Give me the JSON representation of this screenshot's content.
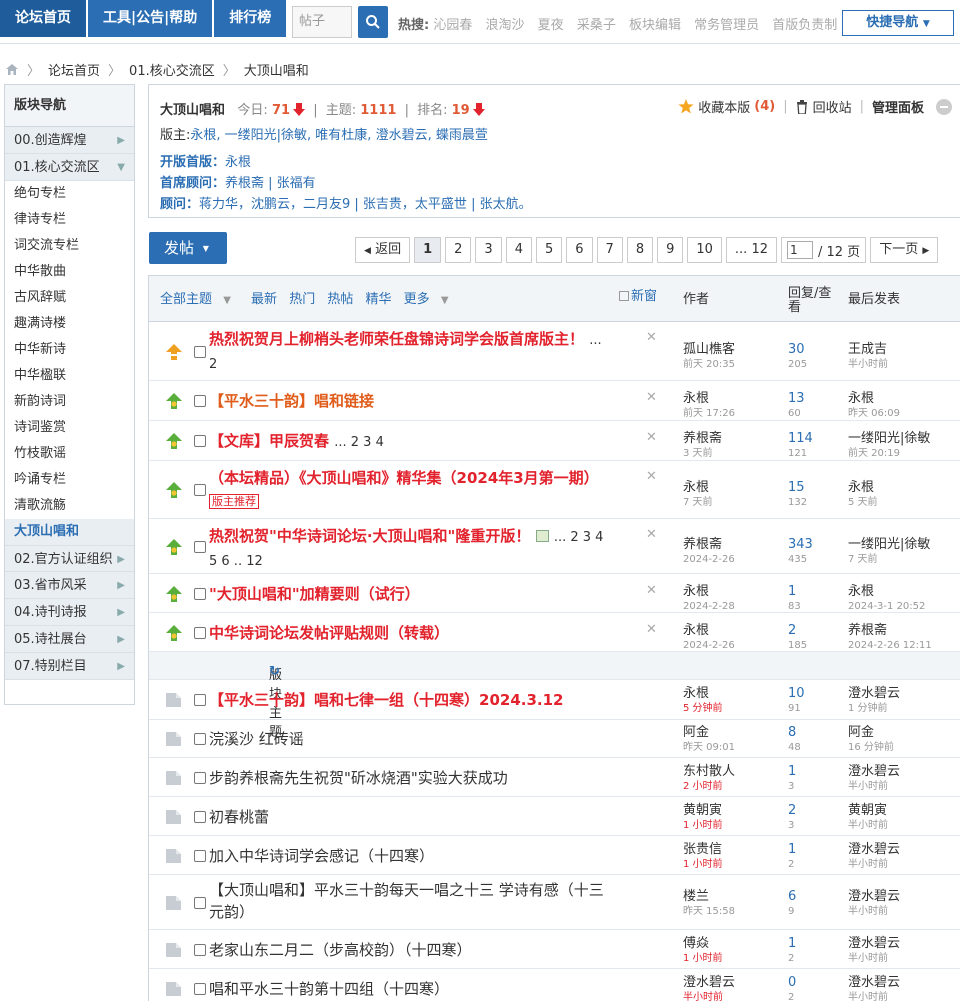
{
  "topnav": {
    "items": [
      "论坛首页",
      "工具|公告|帮助",
      "排行榜"
    ]
  },
  "search": {
    "placeholder": "帖子",
    "scope": "帖子"
  },
  "hot": {
    "label": "热搜:",
    "items": [
      "沁园春",
      "浪淘沙",
      "夏夜",
      "采桑子",
      "板块编辑",
      "常务管理员",
      "首版负责制"
    ]
  },
  "quicknav": "快捷导航",
  "breadcrumb": [
    "论坛首页",
    "01.核心交流区",
    "大顶山唱和"
  ],
  "sidebar": {
    "title": "版块导航",
    "groups_top": [
      "00.创造辉煌",
      "01.核心交流区"
    ],
    "items": [
      "绝句专栏",
      "律诗专栏",
      "词交流专栏",
      "中华散曲",
      "古风辞赋",
      "趣满诗楼",
      "中华新诗",
      "中华楹联",
      "新韵诗词",
      "诗词鉴赏",
      "竹枝歌谣",
      "吟诵专栏",
      "清歌流觞",
      "大顶山唱和"
    ],
    "groups_bottom": [
      "02.官方认证组织",
      "03.省市风采",
      "04.诗刊诗报",
      "05.诗社展台",
      "07.特别栏目"
    ]
  },
  "forum": {
    "name": "大顶山唱和",
    "today_label": "今日:",
    "today": "71",
    "topics_label": "主题:",
    "topics": "1111",
    "rank_label": "排名:",
    "rank": "19",
    "moderators_label": "版主:",
    "moderators": "永根, 一缕阳光|徐敏, 唯有杜康, 澄水碧云, 蝶雨晨萱",
    "first_label": "开版首版：",
    "first": "永根",
    "chief_label": "首席顾问：",
    "chief": "养根斋 | 张福有",
    "advisor_label": "顾问：",
    "advisors": "蒋力华，沈鹏云，二月友9 | 张吉贵，太平盛世 | 张太航。",
    "fav_label": "收藏本版",
    "fav_count": "(4)",
    "recycle": "回收站",
    "manage": "管理面板"
  },
  "post_button": "发帖",
  "pager": {
    "prev": "返回",
    "pages": [
      "1",
      "2",
      "3",
      "4",
      "5",
      "6",
      "7",
      "8",
      "9",
      "10",
      "... 12"
    ],
    "input": "1",
    "total": "/ 12 页",
    "next": "下一页"
  },
  "thead": {
    "filters": [
      "全部主题",
      "最新",
      "热门",
      "热帖",
      "精华",
      "更多"
    ],
    "newwin": "新窗",
    "author": "作者",
    "replies": "回复/查看",
    "last": "最后发表"
  },
  "sticky": [
    {
      "title": "热烈祝贺月上柳梢头老师荣任盘锦诗词学会版首席版主！",
      "pages": "... 2",
      "color": "red",
      "author": "孤山樵客",
      "adate": "前天 20:35",
      "replies": "30",
      "views": "205",
      "last": "王成吉",
      "ldate": "半小时前"
    },
    {
      "title": "【平水三十韵】唱和链接",
      "pages": "",
      "color": "orange",
      "author": "永根",
      "adate": "前天 17:26",
      "replies": "13",
      "views": "60",
      "last": "永根",
      "ldate": "昨天 06:09"
    },
    {
      "title": "【文库】甲辰贺春",
      "pages": "... 2 3 4",
      "color": "red",
      "author": "养根斋",
      "adate": "3 天前",
      "replies": "114",
      "views": "121",
      "last": "一缕阳光|徐敏",
      "ldate": "前天 20:19"
    },
    {
      "title": "（本坛精品）《大顶山唱和》精华集（2024年3月第一期）",
      "pages": "",
      "tag": "版主推荐",
      "color": "red",
      "author": "永根",
      "adate": "7 天前",
      "replies": "15",
      "views": "132",
      "last": "永根",
      "ldate": "5 天前"
    },
    {
      "title": "热烈祝贺\"中华诗词论坛·大顶山唱和\"隆重开版！",
      "pages": "... 2 3 4 5 6 .. 12",
      "color": "red",
      "author": "养根斋",
      "adate": "2024-2-26",
      "replies": "343",
      "views": "435",
      "last": "一缕阳光|徐敏",
      "ldate": "7 天前"
    },
    {
      "title": "\"大顶山唱和\"加精要则（试行）",
      "pages": "",
      "color": "red",
      "author": "永根",
      "adate": "2024-2-28",
      "replies": "1",
      "views": "83",
      "last": "永根",
      "ldate": "2024-3-1 20:52"
    },
    {
      "title": "中华诗词论坛发帖评贴规则（转载）",
      "pages": "",
      "color": "red",
      "author": "永根",
      "adate": "2024-2-26",
      "replies": "2",
      "views": "185",
      "last": "养根斋",
      "ldate": "2024-2-26 12:11"
    }
  ],
  "section_label": "版块主题",
  "normal": [
    {
      "title": "【平水三十韵】唱和七律一组（十四寒）2024.3.12",
      "color": "red",
      "author": "永根",
      "adate": "5 分钟前",
      "ared": true,
      "replies": "10",
      "views": "91",
      "last": "澄水碧云",
      "ldate": "1 分钟前"
    },
    {
      "title": "浣溪沙 红砖谣",
      "color": "plain",
      "author": "阿金",
      "adate": "昨天 09:01",
      "ared": false,
      "replies": "8",
      "views": "48",
      "last": "阿金",
      "ldate": "16 分钟前"
    },
    {
      "title": "步韵养根斋先生祝贺\"斫冰烧酒\"实验大获成功",
      "color": "plain",
      "author": "东村散人",
      "adate": "2 小时前",
      "ared": true,
      "replies": "1",
      "views": "3",
      "last": "澄水碧云",
      "ldate": "半小时前"
    },
    {
      "title": "初春桃蕾",
      "color": "plain",
      "author": "黄朝寅",
      "adate": "1 小时前",
      "ared": true,
      "replies": "2",
      "views": "3",
      "last": "黄朝寅",
      "ldate": "半小时前"
    },
    {
      "title": "加入中华诗词学会感记（十四寒）",
      "color": "plain",
      "author": "张贵信",
      "adate": "1 小时前",
      "ared": true,
      "replies": "1",
      "views": "2",
      "last": "澄水碧云",
      "ldate": "半小时前"
    },
    {
      "title": "【大顶山唱和】平水三十韵每天一唱之十三 学诗有感（十三元韵）",
      "color": "plain",
      "author": "楼兰",
      "adate": "昨天 15:58",
      "ared": false,
      "replies": "6",
      "views": "9",
      "last": "澄水碧云",
      "ldate": "半小时前"
    },
    {
      "title": "老家山东二月二（步高校韵）（十四寒）",
      "color": "plain",
      "author": "傅焱",
      "adate": "1 小时前",
      "ared": true,
      "replies": "1",
      "views": "2",
      "last": "澄水碧云",
      "ldate": "半小时前"
    },
    {
      "title": "唱和平水三十韵第十四组（十四寒）",
      "color": "plain",
      "author": "澄水碧云",
      "adate": "半小时前",
      "ared": true,
      "replies": "0",
      "views": "2",
      "last": "澄水碧云",
      "ldate": "半小时前"
    }
  ],
  "colors": {
    "brand": "#2b6eb3",
    "red": "#e2222c",
    "orange": "#e05c1a",
    "panel": "#f2f5f8"
  }
}
